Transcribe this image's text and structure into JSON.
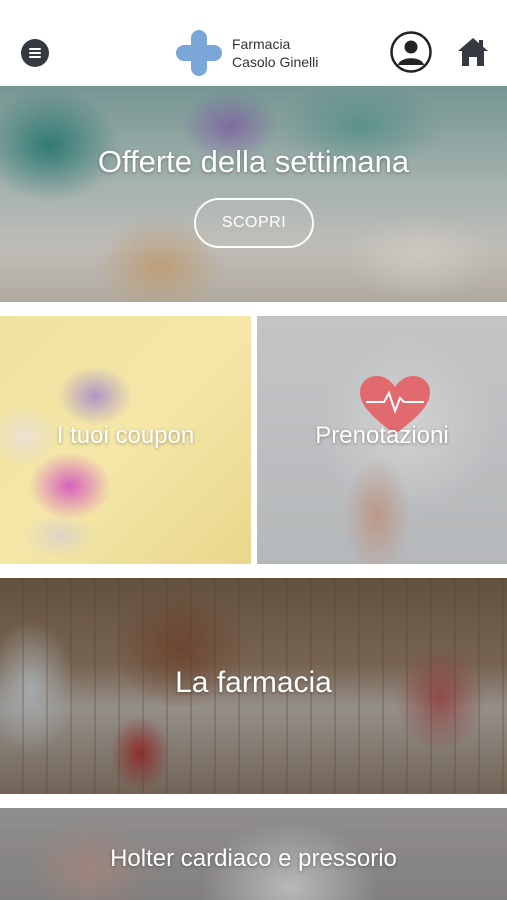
{
  "header": {
    "logo_line1": "Farmacia",
    "logo_line2": "Casolo Ginelli",
    "menu_icon": "hamburger-menu-icon",
    "user_icon": "user-account-icon",
    "home_icon": "home-icon",
    "brand_color": "#7aa7d8"
  },
  "banners": {
    "offers": {
      "title": "Offerte della settimana",
      "button": "SCOPRI"
    },
    "coupons": {
      "title": "I tuoi coupon"
    },
    "bookings": {
      "title": "Prenotazioni"
    },
    "pharmacy": {
      "title": "La farmacia"
    },
    "holter": {
      "title": "Holter cardiaco e pressorio"
    }
  }
}
